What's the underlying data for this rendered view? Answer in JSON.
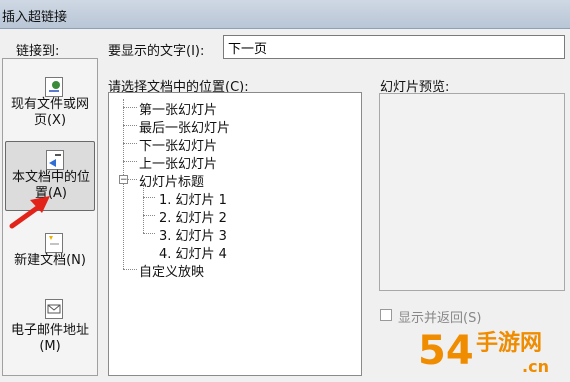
{
  "window": {
    "title": "插入超链接"
  },
  "sidebar": {
    "heading": "链接到:",
    "items": [
      {
        "label_line1": "现有文件或网",
        "label_line2": "页(X)"
      },
      {
        "label_line1": "本文档中的位",
        "label_line2": "置(A)",
        "selected": true
      },
      {
        "label_line1": "新建文档(N)",
        "label_line2": ""
      },
      {
        "label_line1": "电子邮件地址",
        "label_line2": "(M)"
      }
    ]
  },
  "text_to_display": {
    "label": "要显示的文字(I):",
    "value": "下一页"
  },
  "location_tree": {
    "label": "请选择文档中的位置(C):",
    "items": [
      "第一张幻灯片",
      "最后一张幻灯片",
      "下一张幻灯片",
      "上一张幻灯片",
      "幻灯片标题",
      "1. 幻灯片 1",
      "2. 幻灯片 2",
      "3. 幻灯片 3",
      "4. 幻灯片 4",
      "自定义放映"
    ],
    "expander_symbol": "−"
  },
  "preview": {
    "label": "幻灯片预览:"
  },
  "show_and_return": {
    "label": "显示并返回(S)",
    "checked": false,
    "enabled": false
  },
  "watermark": {
    "number": "54",
    "site_cn": "手游网",
    "site_url": ".cn"
  },
  "colors": {
    "arrow": "#e2231a",
    "watermark_orange": "#f08c00"
  },
  "icons": [
    "web-page-icon",
    "document-location-icon",
    "new-document-icon",
    "email-icon"
  ]
}
